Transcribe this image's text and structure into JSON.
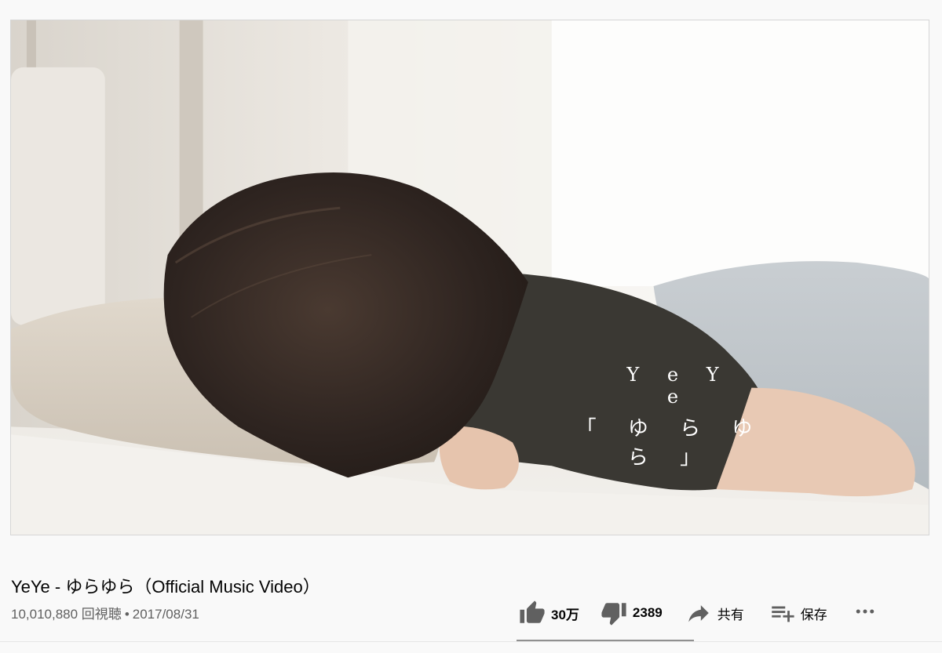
{
  "video": {
    "overlay_artist": "Y e Y e",
    "overlay_song": "「 ゆ ら ゆ ら 」",
    "title": "YeYe - ゆらゆら（Official Music Video）",
    "views": "10,010,880 回視聴",
    "separator": "•",
    "date": "2017/08/31"
  },
  "actions": {
    "like_count": "30万",
    "dislike_count": "2389",
    "share_label": "共有",
    "save_label": "保存",
    "like_ratio": 0.99
  },
  "icons": {
    "like": "thumb-up-icon",
    "dislike": "thumb-down-icon",
    "share": "share-arrow-icon",
    "save": "playlist-add-icon",
    "more": "more-horizontal-icon"
  },
  "colors": {
    "background": "#f9f9f9",
    "text": "#030303",
    "secondary_text": "#606060",
    "icon": "#606060"
  }
}
